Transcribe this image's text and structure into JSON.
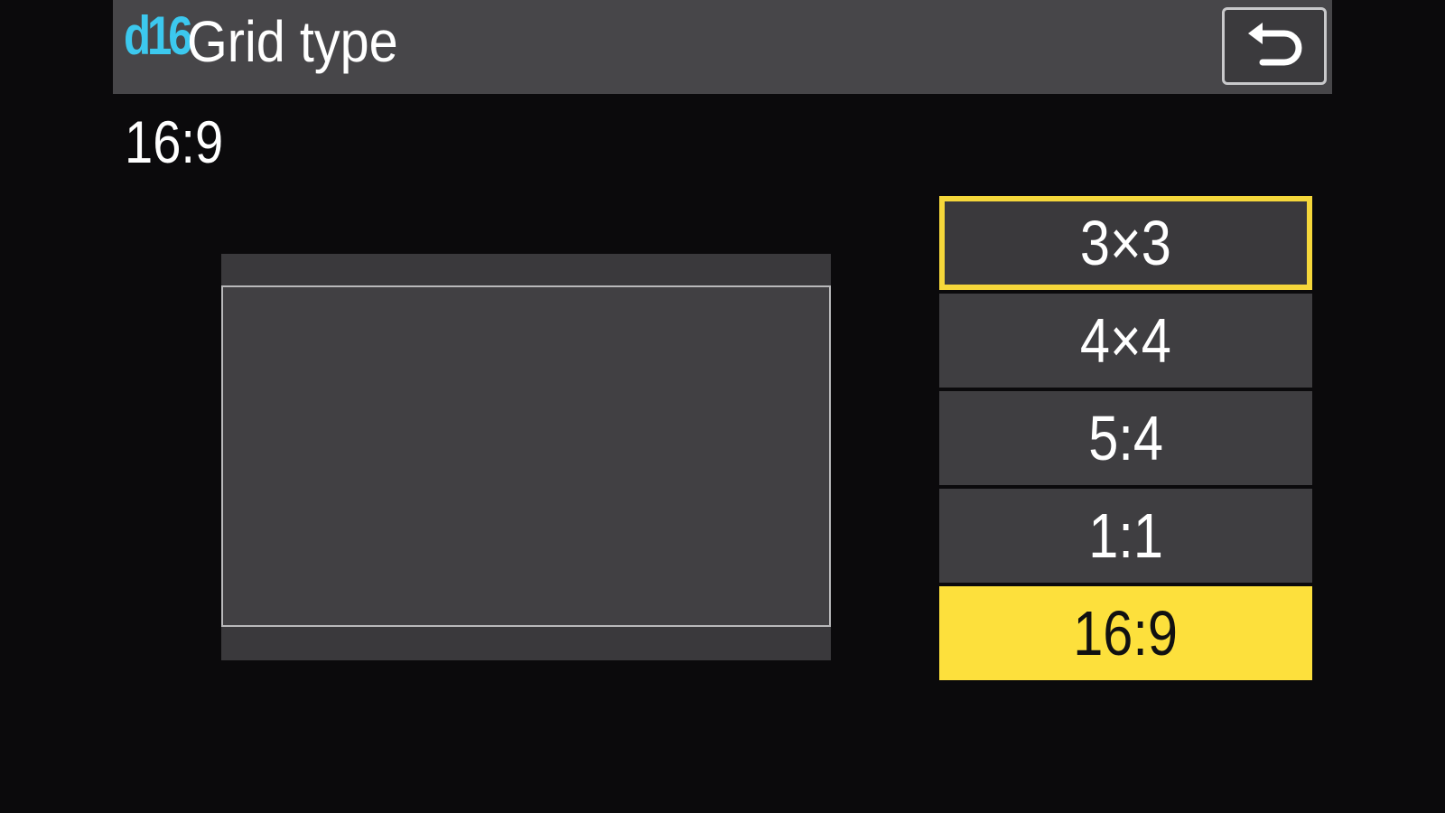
{
  "header": {
    "code": "d16",
    "code_color": "#3cc8ee",
    "title": "Grid type",
    "back_icon": "return-arrow-icon"
  },
  "current_value": "16:9",
  "options": [
    {
      "label": "3×3",
      "state": "focused"
    },
    {
      "label": "4×4",
      "state": "normal"
    },
    {
      "label": "5:4",
      "state": "normal"
    },
    {
      "label": "1:1",
      "state": "normal"
    },
    {
      "label": "16:9",
      "state": "selected"
    }
  ],
  "colors": {
    "background": "#0b0a0c",
    "header": "#474649",
    "option": "#3f3e41",
    "highlight": "#fde03c"
  }
}
